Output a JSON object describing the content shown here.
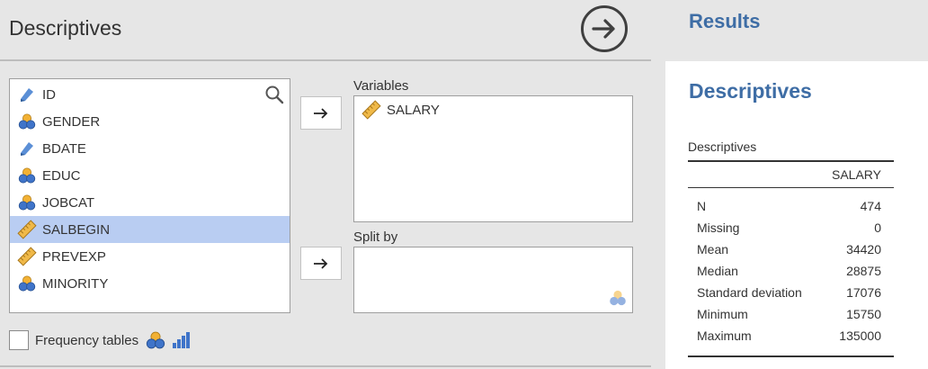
{
  "options": {
    "title": "Descriptives",
    "variables_label": "Variables",
    "splitby_label": "Split by",
    "frequency_label": "Frequency tables",
    "available": [
      {
        "label": "ID",
        "icon": "nominal-text-icon"
      },
      {
        "label": "GENDER",
        "icon": "nominal-icon"
      },
      {
        "label": "BDATE",
        "icon": "nominal-text-icon"
      },
      {
        "label": "EDUC",
        "icon": "nominal-icon"
      },
      {
        "label": "JOBCAT",
        "icon": "nominal-icon"
      },
      {
        "label": "SALBEGIN",
        "icon": "continuous-icon",
        "selected": true
      },
      {
        "label": "PREVEXP",
        "icon": "continuous-icon"
      },
      {
        "label": "MINORITY",
        "icon": "nominal-icon"
      }
    ],
    "variables": [
      {
        "label": "SALARY",
        "icon": "continuous-icon"
      }
    ],
    "split_by": []
  },
  "results": {
    "title": "Results",
    "heading": "Descriptives",
    "table_caption": "Descriptives",
    "column": "SALARY",
    "rows": [
      {
        "label": "N",
        "value": "474"
      },
      {
        "label": "Missing",
        "value": "0"
      },
      {
        "label": "Mean",
        "value": "34420"
      },
      {
        "label": "Median",
        "value": "28875"
      },
      {
        "label": "Standard deviation",
        "value": "17076"
      },
      {
        "label": "Minimum",
        "value": "15750"
      },
      {
        "label": "Maximum",
        "value": "135000"
      }
    ]
  },
  "colors": {
    "accent": "#3e6da5",
    "selected_row": "#b9cdf2",
    "nominal_top": "#f2b134",
    "nominal_bottom": "#3f74c9",
    "ruler": "#f0b948"
  }
}
